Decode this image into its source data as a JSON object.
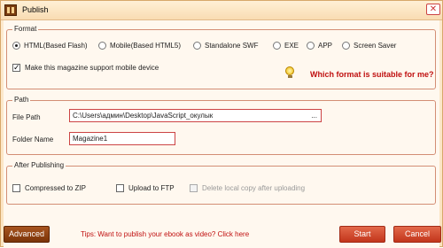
{
  "window": {
    "title": "Publish"
  },
  "format": {
    "legend": "Format",
    "options": [
      {
        "label": "HTML(Based Flash)",
        "selected": true
      },
      {
        "label": "Mobile(Based HTML5)",
        "selected": false
      },
      {
        "label": "Standalone SWF",
        "selected": false
      },
      {
        "label": "EXE",
        "selected": false
      },
      {
        "label": "APP",
        "selected": false
      },
      {
        "label": "Screen Saver",
        "selected": false
      }
    ],
    "mobile_support_label": "Make this magazine support mobile device",
    "mobile_support_checked": true,
    "suitable_link": "Which format is suitable for me?"
  },
  "path": {
    "legend": "Path",
    "file_path_label": "File Path",
    "file_path_value": "C:\\Users\\админ\\Desktop\\JavaScript_окулык",
    "browse_label": "...",
    "folder_name_label": "Folder Name",
    "folder_name_value": "Magazine1"
  },
  "after_publishing": {
    "legend": "After Publishing",
    "compress_label": "Compressed to ZIP",
    "upload_label": "Upload to FTP",
    "delete_label": "Delete local copy after uploading"
  },
  "footer": {
    "advanced_label": "Advanced",
    "tips": "Tips: Want to publish your ebook as video? Click here",
    "start_label": "Start",
    "cancel_label": "Cancel"
  },
  "colors": {
    "accent": "#c01010",
    "border": "#d38e75",
    "button": "#c2351b"
  }
}
